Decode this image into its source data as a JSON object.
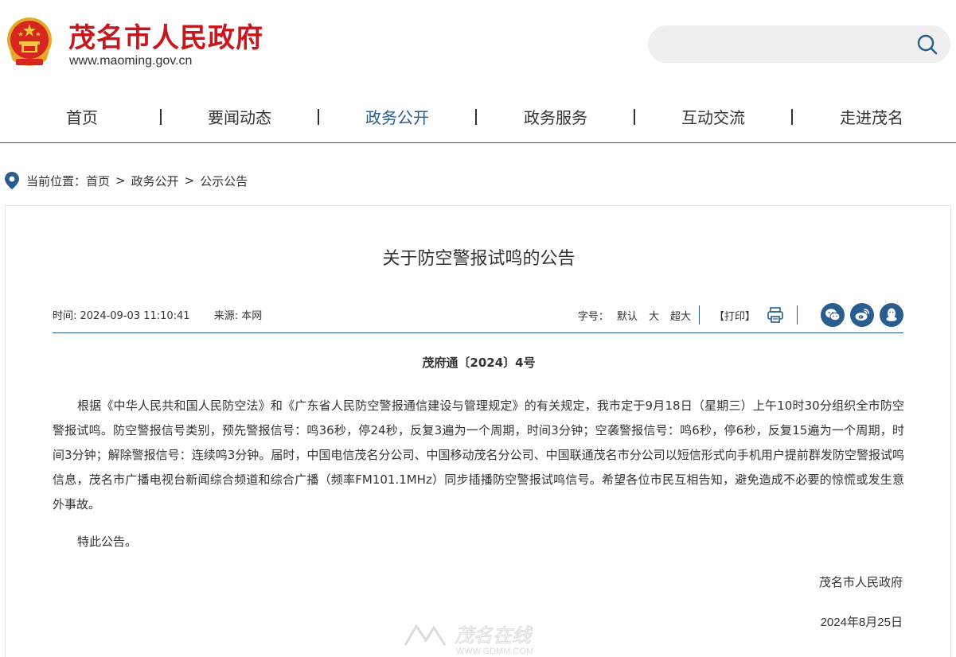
{
  "header": {
    "site_name": "茂名市人民政府",
    "site_url": "www.maoming.gov.cn",
    "search": {
      "placeholder": "",
      "value": ""
    }
  },
  "nav": {
    "items": [
      {
        "label": "首页"
      },
      {
        "label": "要闻动态"
      },
      {
        "label": "政务公开"
      },
      {
        "label": "政务服务"
      },
      {
        "label": "互动交流"
      },
      {
        "label": "走进茂名"
      }
    ],
    "active_index": 2
  },
  "breadcrumb": {
    "prefix": "当前位置：",
    "items": [
      "首页",
      "政务公开",
      "公示公告"
    ],
    "separator": ">"
  },
  "article": {
    "title": "关于防空警报试鸣的公告",
    "meta": {
      "time": "时间: 2024-09-03 11:10:41",
      "source": "来源: 本网",
      "font_size_label": "字号：",
      "font_options": [
        "默认",
        "大",
        "超大"
      ],
      "print_label": "【打印】"
    },
    "share_icons": [
      "wechat-icon",
      "weibo-icon",
      "qq-icon"
    ],
    "doc_number": "茂府通〔2024〕4号",
    "body": "根据《中华人民共和国人民防空法》和《广东省人民防空警报通信建设与管理规定》的有关规定，我市定于9月18日（星期三）上午10时30分组织全市防空警报试鸣。防空警报信号类别，预先警报信号：鸣36秒，停24秒，反复3遍为一个周期，时间3分钟；空袭警报信号：鸣6秒，停6秒，反复15遍为一个周期，时间3分钟；解除警报信号：连续鸣3分钟。届时，中国电信茂名分公司、中国移动茂名分公司、中国联通茂名市分公司以短信形式向手机用户提前群发防空警报试鸣信息，茂名市广播电视台新闻综合频道和综合广播（频率FM101.1MHz）同步插播防空警报试鸣信号。希望各位市民互相告知，避免造成不必要的惊慌或发生意外事故。",
    "closing": "特此公告。",
    "signature": "茂名市人民政府",
    "date": "2024年8月25日"
  },
  "watermark": {
    "text": "茂名在线",
    "url": "WWW.GDMM.COM"
  },
  "colors": {
    "brand_red": "#c8161d",
    "accent_blue": "#2a5d8f",
    "text": "#333333",
    "search_bg": "#efefef"
  }
}
